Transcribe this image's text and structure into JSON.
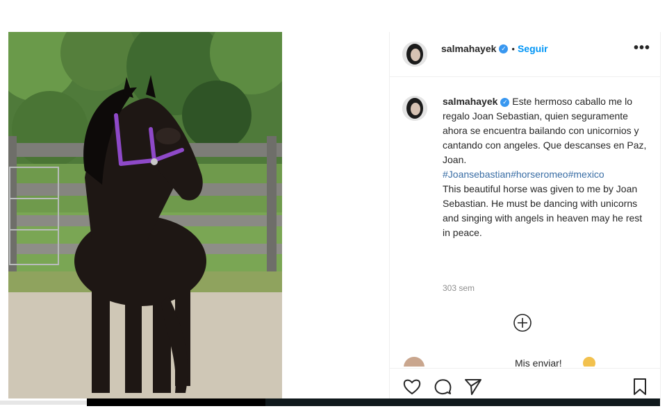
{
  "post": {
    "username": "salmahayek",
    "header_dot": "•",
    "follow_label": "Seguir",
    "more_label": "•••",
    "caption_spanish": "Este hermoso caballo me lo regalo Joan Sebastian, quien seguramente ahora se encuentra bailando con unicornios y cantando con angeles. Que descanses en Paz, Joan.",
    "hashtags": [
      "#Joansebastian",
      "#horseromeo",
      "#mexico"
    ],
    "caption_english": "This beautiful horse was given to me by Joan Sebastian. He must be dancing with unicorns and singing with angels in heaven may he rest in peace.",
    "timestamp": "303 sem",
    "next_comment_peek": "Mis enviar!",
    "icons": [
      "heart-icon",
      "comment-icon",
      "share-icon",
      "bookmark-icon",
      "add-comment-icon",
      "verified-badge-icon",
      "more-options-icon"
    ],
    "colors": {
      "link": "#0095f6",
      "hashtag": "#3a6ea5",
      "verified": "#3897f0",
      "muted": "#8e8e8e"
    }
  }
}
